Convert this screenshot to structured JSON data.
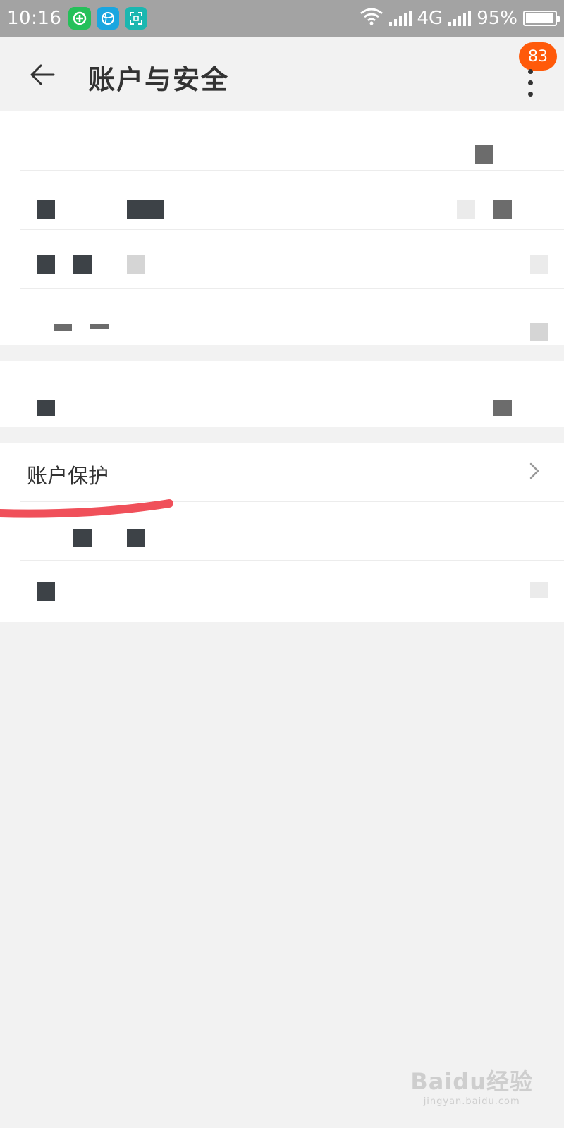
{
  "status_bar": {
    "time": "10:16",
    "network": "4G",
    "battery": "95%",
    "battery_level": 0.95
  },
  "header": {
    "title": "账户与安全",
    "badge_count": "83"
  },
  "list": {
    "account_protection_label": "账户保护"
  },
  "watermark": {
    "brand": "Baidu经验",
    "url": "jingyan.baidu.com"
  },
  "colors": {
    "badge": "#ff5a0a",
    "status_bar": "#a3a3a3",
    "background": "#f2f2f2",
    "scribble": "#f0505a"
  },
  "icons": [
    "back-arrow-icon",
    "more-vertical-icon",
    "chevron-right-icon",
    "wifi-icon",
    "signal-icon",
    "battery-icon"
  ]
}
